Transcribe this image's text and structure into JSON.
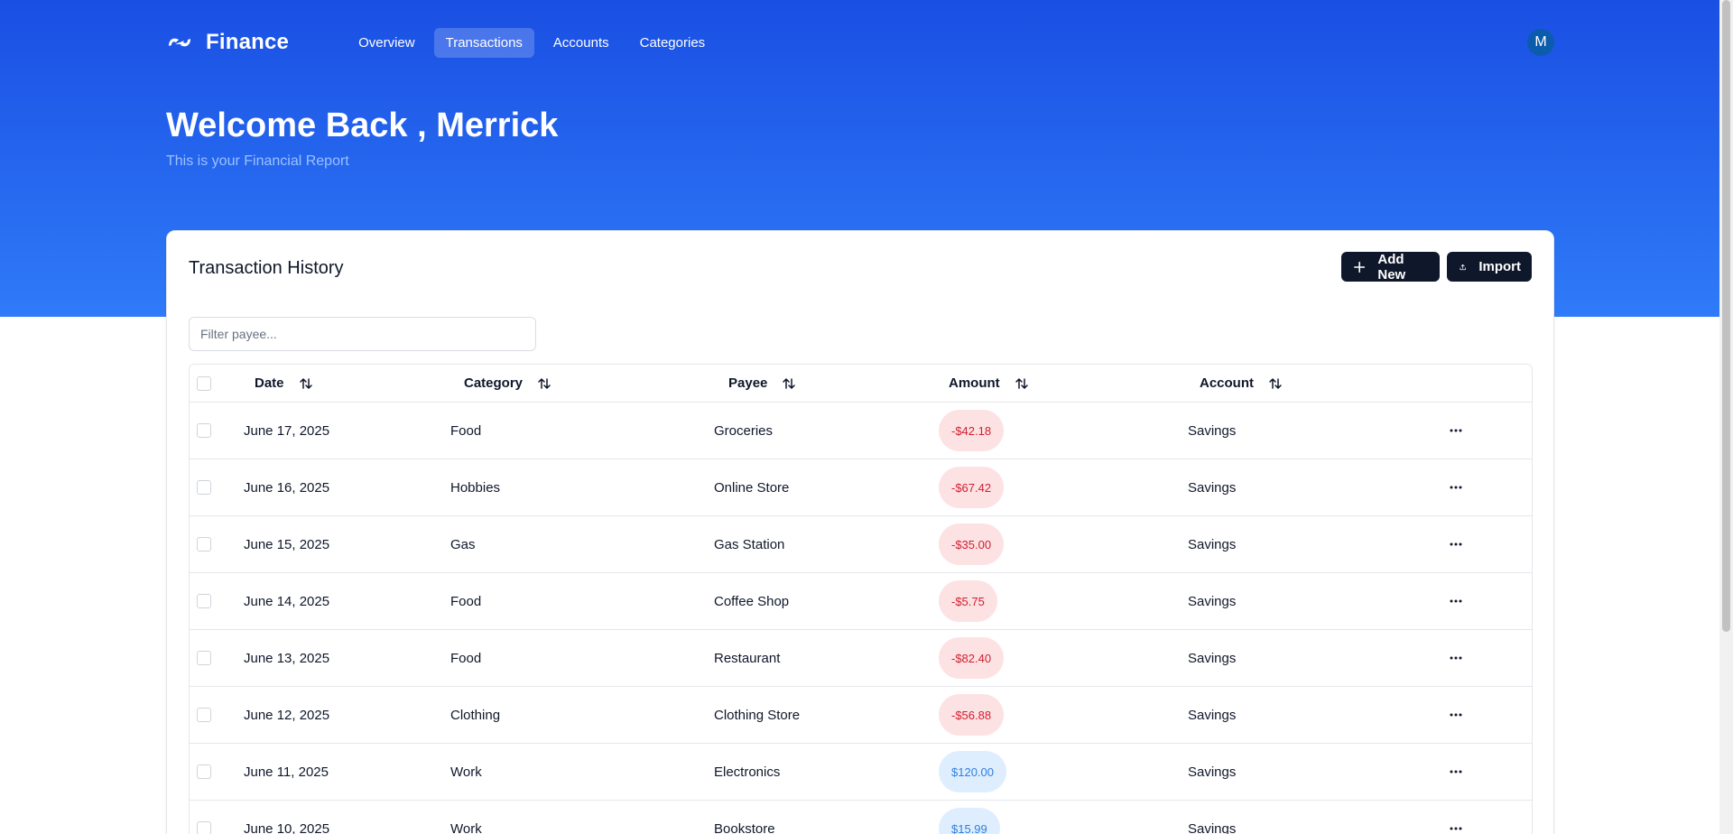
{
  "brand": {
    "name": "Finance"
  },
  "nav": {
    "items": [
      {
        "label": "Overview"
      },
      {
        "label": "Transactions"
      },
      {
        "label": "Accounts"
      },
      {
        "label": "Categories"
      }
    ],
    "active": "Transactions"
  },
  "user": {
    "initial": "M"
  },
  "hero": {
    "title": "Welcome Back , Merrick",
    "subtitle": "This is your Financial Report"
  },
  "card": {
    "title": "Transaction History",
    "add_label": "Add New",
    "import_label": "Import",
    "filter_placeholder": "Filter payee..."
  },
  "table": {
    "columns": [
      "Date",
      "Category",
      "Payee",
      "Amount",
      "Account"
    ],
    "rows": [
      {
        "date": "June 17, 2025",
        "category": "Food",
        "payee": "Groceries",
        "amount": "-$42.18",
        "type": "neg",
        "account": "Savings"
      },
      {
        "date": "June 16, 2025",
        "category": "Hobbies",
        "payee": "Online Store",
        "amount": "-$67.42",
        "type": "neg",
        "account": "Savings"
      },
      {
        "date": "June 15, 2025",
        "category": "Gas",
        "payee": "Gas Station",
        "amount": "-$35.00",
        "type": "neg",
        "account": "Savings"
      },
      {
        "date": "June 14, 2025",
        "category": "Food",
        "payee": "Coffee Shop",
        "amount": "-$5.75",
        "type": "neg",
        "account": "Savings"
      },
      {
        "date": "June 13, 2025",
        "category": "Food",
        "payee": "Restaurant",
        "amount": "-$82.40",
        "type": "neg",
        "account": "Savings"
      },
      {
        "date": "June 12, 2025",
        "category": "Clothing",
        "payee": "Clothing Store",
        "amount": "-$56.88",
        "type": "neg",
        "account": "Savings"
      },
      {
        "date": "June 11, 2025",
        "category": "Work",
        "payee": "Electronics",
        "amount": "$120.00",
        "type": "pos",
        "account": "Savings"
      },
      {
        "date": "June 10, 2025",
        "category": "Work",
        "payee": "Bookstore",
        "amount": "$15.99",
        "type": "pos",
        "account": "Savings"
      }
    ]
  },
  "colors": {
    "hero_top": "#1a4fe3",
    "hero_bottom": "#2f7bf8",
    "primary_button": "#0f172a",
    "negative_bg": "#fde2e4",
    "negative_text": "#d11f2e",
    "positive_bg": "#dfeefe",
    "positive_text": "#2d7fe0"
  }
}
